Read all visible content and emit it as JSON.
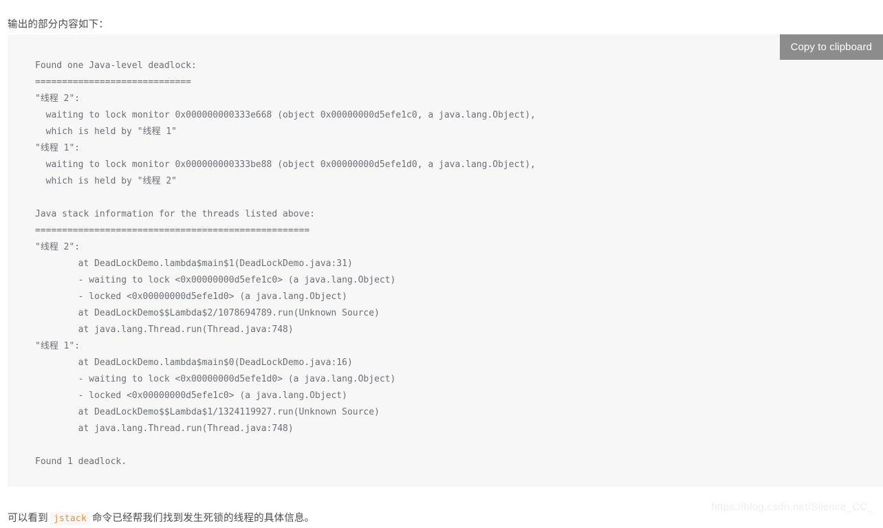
{
  "intro": {
    "text": "输出的部分内容如下："
  },
  "code_block": {
    "copy_button_label": "Copy to clipboard",
    "language": "plaintext",
    "content": "Found one Java-level deadlock:\n=============================\n\"线程 2\":\n  waiting to lock monitor 0x000000000333e668 (object 0x00000000d5efe1c0, a java.lang.Object),\n  which is held by \"线程 1\"\n\"线程 1\":\n  waiting to lock monitor 0x000000000333be88 (object 0x00000000d5efe1d0, a java.lang.Object),\n  which is held by \"线程 2\"\n\nJava stack information for the threads listed above:\n===================================================\n\"线程 2\":\n        at DeadLockDemo.lambda$main$1(DeadLockDemo.java:31)\n        - waiting to lock <0x00000000d5efe1c0> (a java.lang.Object)\n        - locked <0x00000000d5efe1d0> (a java.lang.Object)\n        at DeadLockDemo$$Lambda$2/1078694789.run(Unknown Source)\n        at java.lang.Thread.run(Thread.java:748)\n\"线程 1\":\n        at DeadLockDemo.lambda$main$0(DeadLockDemo.java:16)\n        - waiting to lock <0x00000000d5efe1d0> (a java.lang.Object)\n        - locked <0x00000000d5efe1c0> (a java.lang.Object)\n        at DeadLockDemo$$Lambda$1/1324119927.run(Unknown Source)\n        at java.lang.Thread.run(Thread.java:748)\n\nFound 1 deadlock.\n",
    "lines": [
      "Found one Java-level deadlock:",
      "=============================",
      "\"线程 2\":",
      "  waiting to lock monitor 0x000000000333e668 (object 0x00000000d5efe1c0, a java.lang.Object),",
      "  which is held by \"线程 1\"",
      "\"线程 1\":",
      "  waiting to lock monitor 0x000000000333be88 (object 0x00000000d5efe1d0, a java.lang.Object),",
      "  which is held by \"线程 2\"",
      "",
      "Java stack information for the threads listed above:",
      "===================================================",
      "\"线程 2\":",
      "        at DeadLockDemo.lambda$main$1(DeadLockDemo.java:31)",
      "        - waiting to lock <0x00000000d5efe1c0> (a java.lang.Object)",
      "        - locked <0x00000000d5efe1d0> (a java.lang.Object)",
      "        at DeadLockDemo$$Lambda$2/1078694789.run(Unknown Source)",
      "        at java.lang.Thread.run(Thread.java:748)",
      "\"线程 1\":",
      "        at DeadLockDemo.lambda$main$0(DeadLockDemo.java:16)",
      "        - waiting to lock <0x00000000d5efe1d0> (a java.lang.Object)",
      "        - locked <0x00000000d5efe1c0> (a java.lang.Object)",
      "        at DeadLockDemo$$Lambda$1/1324119927.run(Unknown Source)",
      "        at java.lang.Thread.run(Thread.java:748)",
      "",
      "Found 1 deadlock."
    ]
  },
  "closing": {
    "before_code": "可以看到",
    "inline_code": "jstack",
    "after_code": "命令已经帮我们找到发生死锁的线程的具体信息。"
  },
  "watermark": {
    "text": "https://blog.csdn.net/Silence_CC_"
  },
  "colors": {
    "page_background": "#ffffff",
    "code_background": "#f7f7f8",
    "code_text": "#6a6f75",
    "copy_button_background": "#8c8c8c",
    "copy_button_text": "#ffffff",
    "body_text": "#4d4d4d",
    "inline_code_text": "#e8912d",
    "watermark_text": "#eeeeee"
  }
}
